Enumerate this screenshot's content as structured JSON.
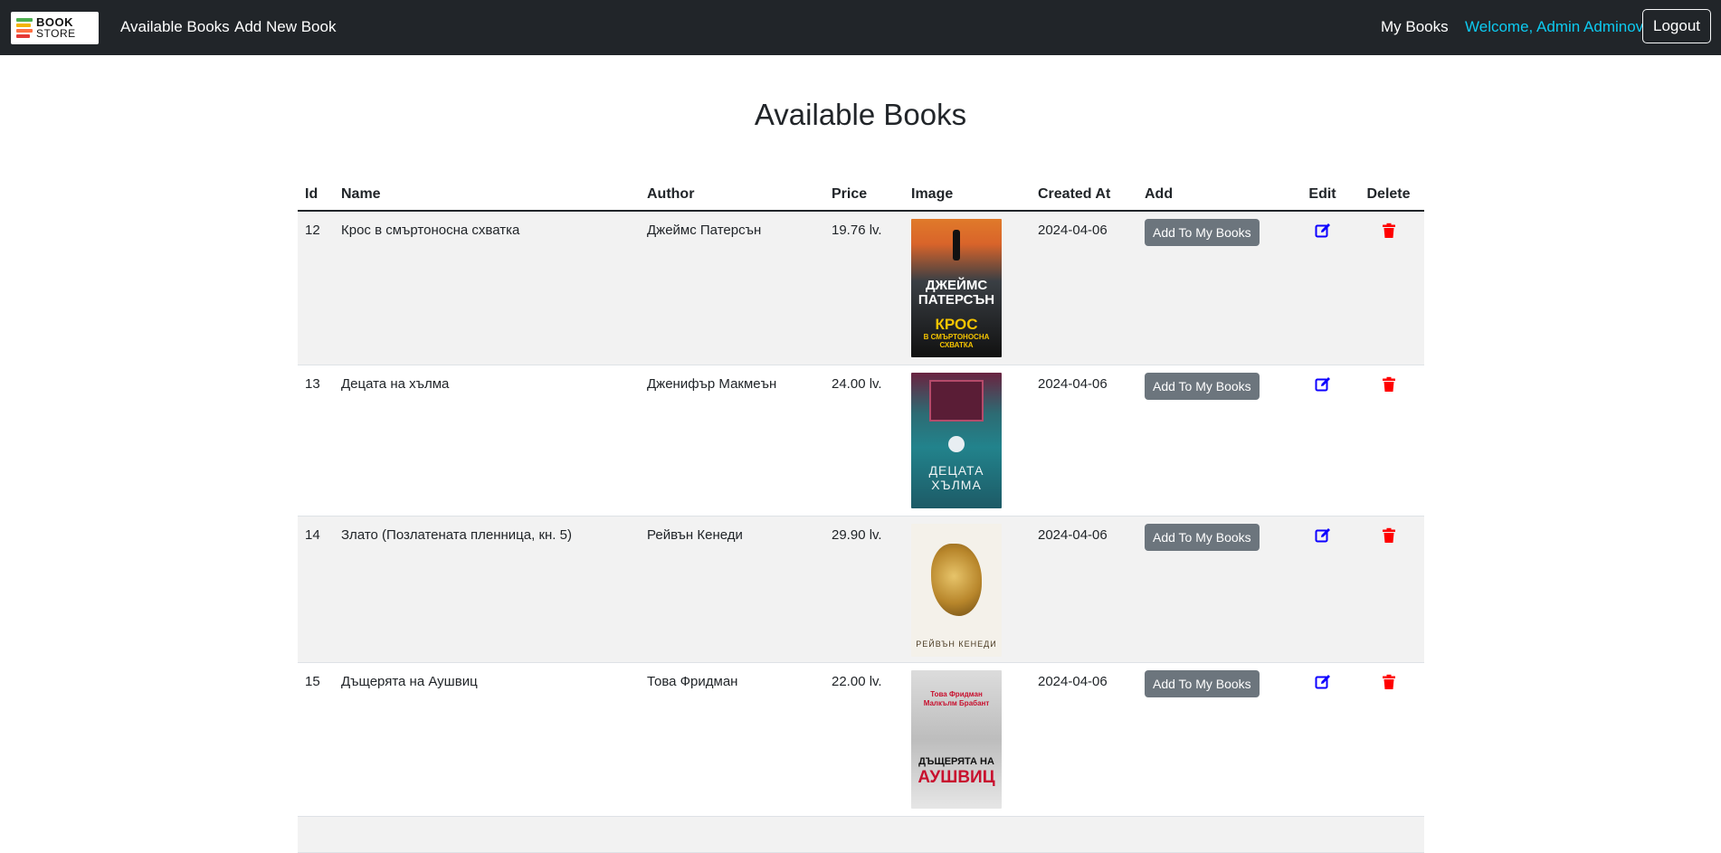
{
  "nav": {
    "logo_top": "BOOK",
    "logo_bottom": "STORE",
    "available_books": "Available Books",
    "add_new_book": "Add New Book",
    "my_books": "My Books",
    "welcome": "Welcome, Admin Adminov",
    "logout": "Logout"
  },
  "page": {
    "title": "Available Books"
  },
  "table": {
    "headers": {
      "id": "Id",
      "name": "Name",
      "author": "Author",
      "price": "Price",
      "image": "Image",
      "created_at": "Created At",
      "add": "Add",
      "edit": "Edit",
      "delete": "Delete"
    },
    "add_button_label": "Add To My Books",
    "rows": [
      {
        "id": "12",
        "name": "Крос в смъртоносна схватка",
        "author": "Джеймс Патерсън",
        "price": "19.76 lv.",
        "created_at": "2024-04-06",
        "cover": {
          "line1": "ДЖЕЙМС",
          "line2": "ПАТЕРСЪН",
          "line3": "КРОС",
          "line4": "В СМЪРТОНОСНА",
          "line5": "СХВАТКА"
        }
      },
      {
        "id": "13",
        "name": "Децата на хълма",
        "author": "Дженифър Макмеън",
        "price": "24.00 lv.",
        "created_at": "2024-04-06",
        "cover": {
          "line1": "ДЕЦАТА",
          "line2": "ХЪЛМА"
        }
      },
      {
        "id": "14",
        "name": "Злато (Позлатената пленница, кн. 5)",
        "author": "Рейвън Кенеди",
        "price": "29.90 lv.",
        "created_at": "2024-04-06",
        "cover": {
          "line1": "РЕЙВЪН КЕНЕДИ"
        }
      },
      {
        "id": "15",
        "name": "Дъщерята на Аушвиц",
        "author": "Това Фридман",
        "price": "22.00 lv.",
        "created_at": "2024-04-06",
        "cover": {
          "line1": "Това Фридман",
          "line2": "Малкълм Брабант",
          "line3": "ДЪЩЕРЯТА НА",
          "line4": "АУШВИЦ"
        }
      }
    ]
  },
  "colors": {
    "navbar_bg": "#212529",
    "welcome": "#0dcaf0",
    "add_button": "#6c757d",
    "edit_icon": "#0d00ff",
    "delete_icon": "#ff0000",
    "stripe": "#f2f2f2"
  },
  "icons": {
    "edit": "edit-icon",
    "delete": "trash-icon"
  }
}
